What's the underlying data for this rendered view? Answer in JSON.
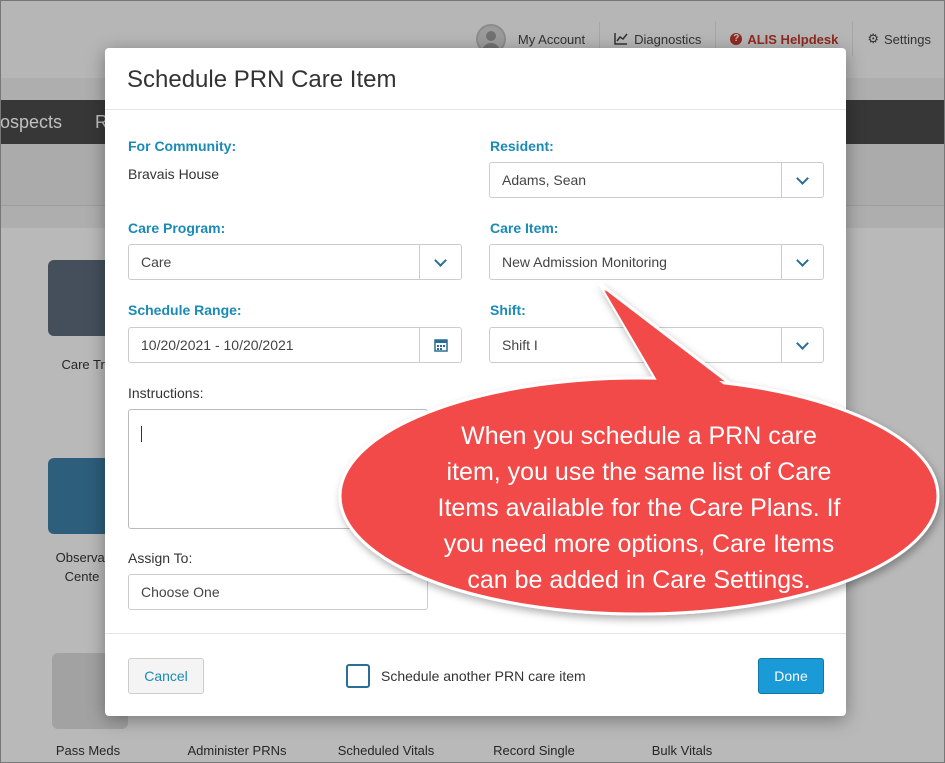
{
  "topnav": {
    "account": "My Account",
    "diagnostics": "Diagnostics",
    "helpdesk": "ALIS Helpdesk",
    "settings": "Settings"
  },
  "background": {
    "menu_prospects": "ospects",
    "menu_next": "R",
    "tiles": [
      "Care Trac",
      "Observat",
      "Cente",
      "Pass Meds",
      "Administer PRNs",
      "Scheduled Vitals",
      "Record Single",
      "Bulk Vitals"
    ]
  },
  "modal": {
    "title": "Schedule PRN Care Item",
    "community_label": "For Community:",
    "community_value": "Bravais House",
    "resident_label": "Resident:",
    "resident_value": "Adams, Sean",
    "program_label": "Care Program:",
    "program_value": "Care",
    "care_item_label": "Care Item:",
    "care_item_value": "New Admission Monitoring",
    "range_label": "Schedule Range:",
    "range_value": "10/20/2021 - 10/20/2021",
    "shift_label": "Shift:",
    "shift_value": "Shift I",
    "instructions_label": "Instructions:",
    "assign_label": "Assign To:",
    "assign_value": "Choose One",
    "cancel": "Cancel",
    "schedule_another": "Schedule another PRN care item",
    "done": "Done"
  },
  "callout": {
    "line1": "When you schedule a PRN care",
    "line2": "item, you use the same list of Care",
    "line3": "Items available for the Care Plans. If",
    "line4": "you need more options, Care Items",
    "line5": "can be added in Care Settings."
  },
  "colors": {
    "label_blue": "#1a8ab7",
    "done_button": "#1a9ad6",
    "callout_red": "#f24848"
  }
}
